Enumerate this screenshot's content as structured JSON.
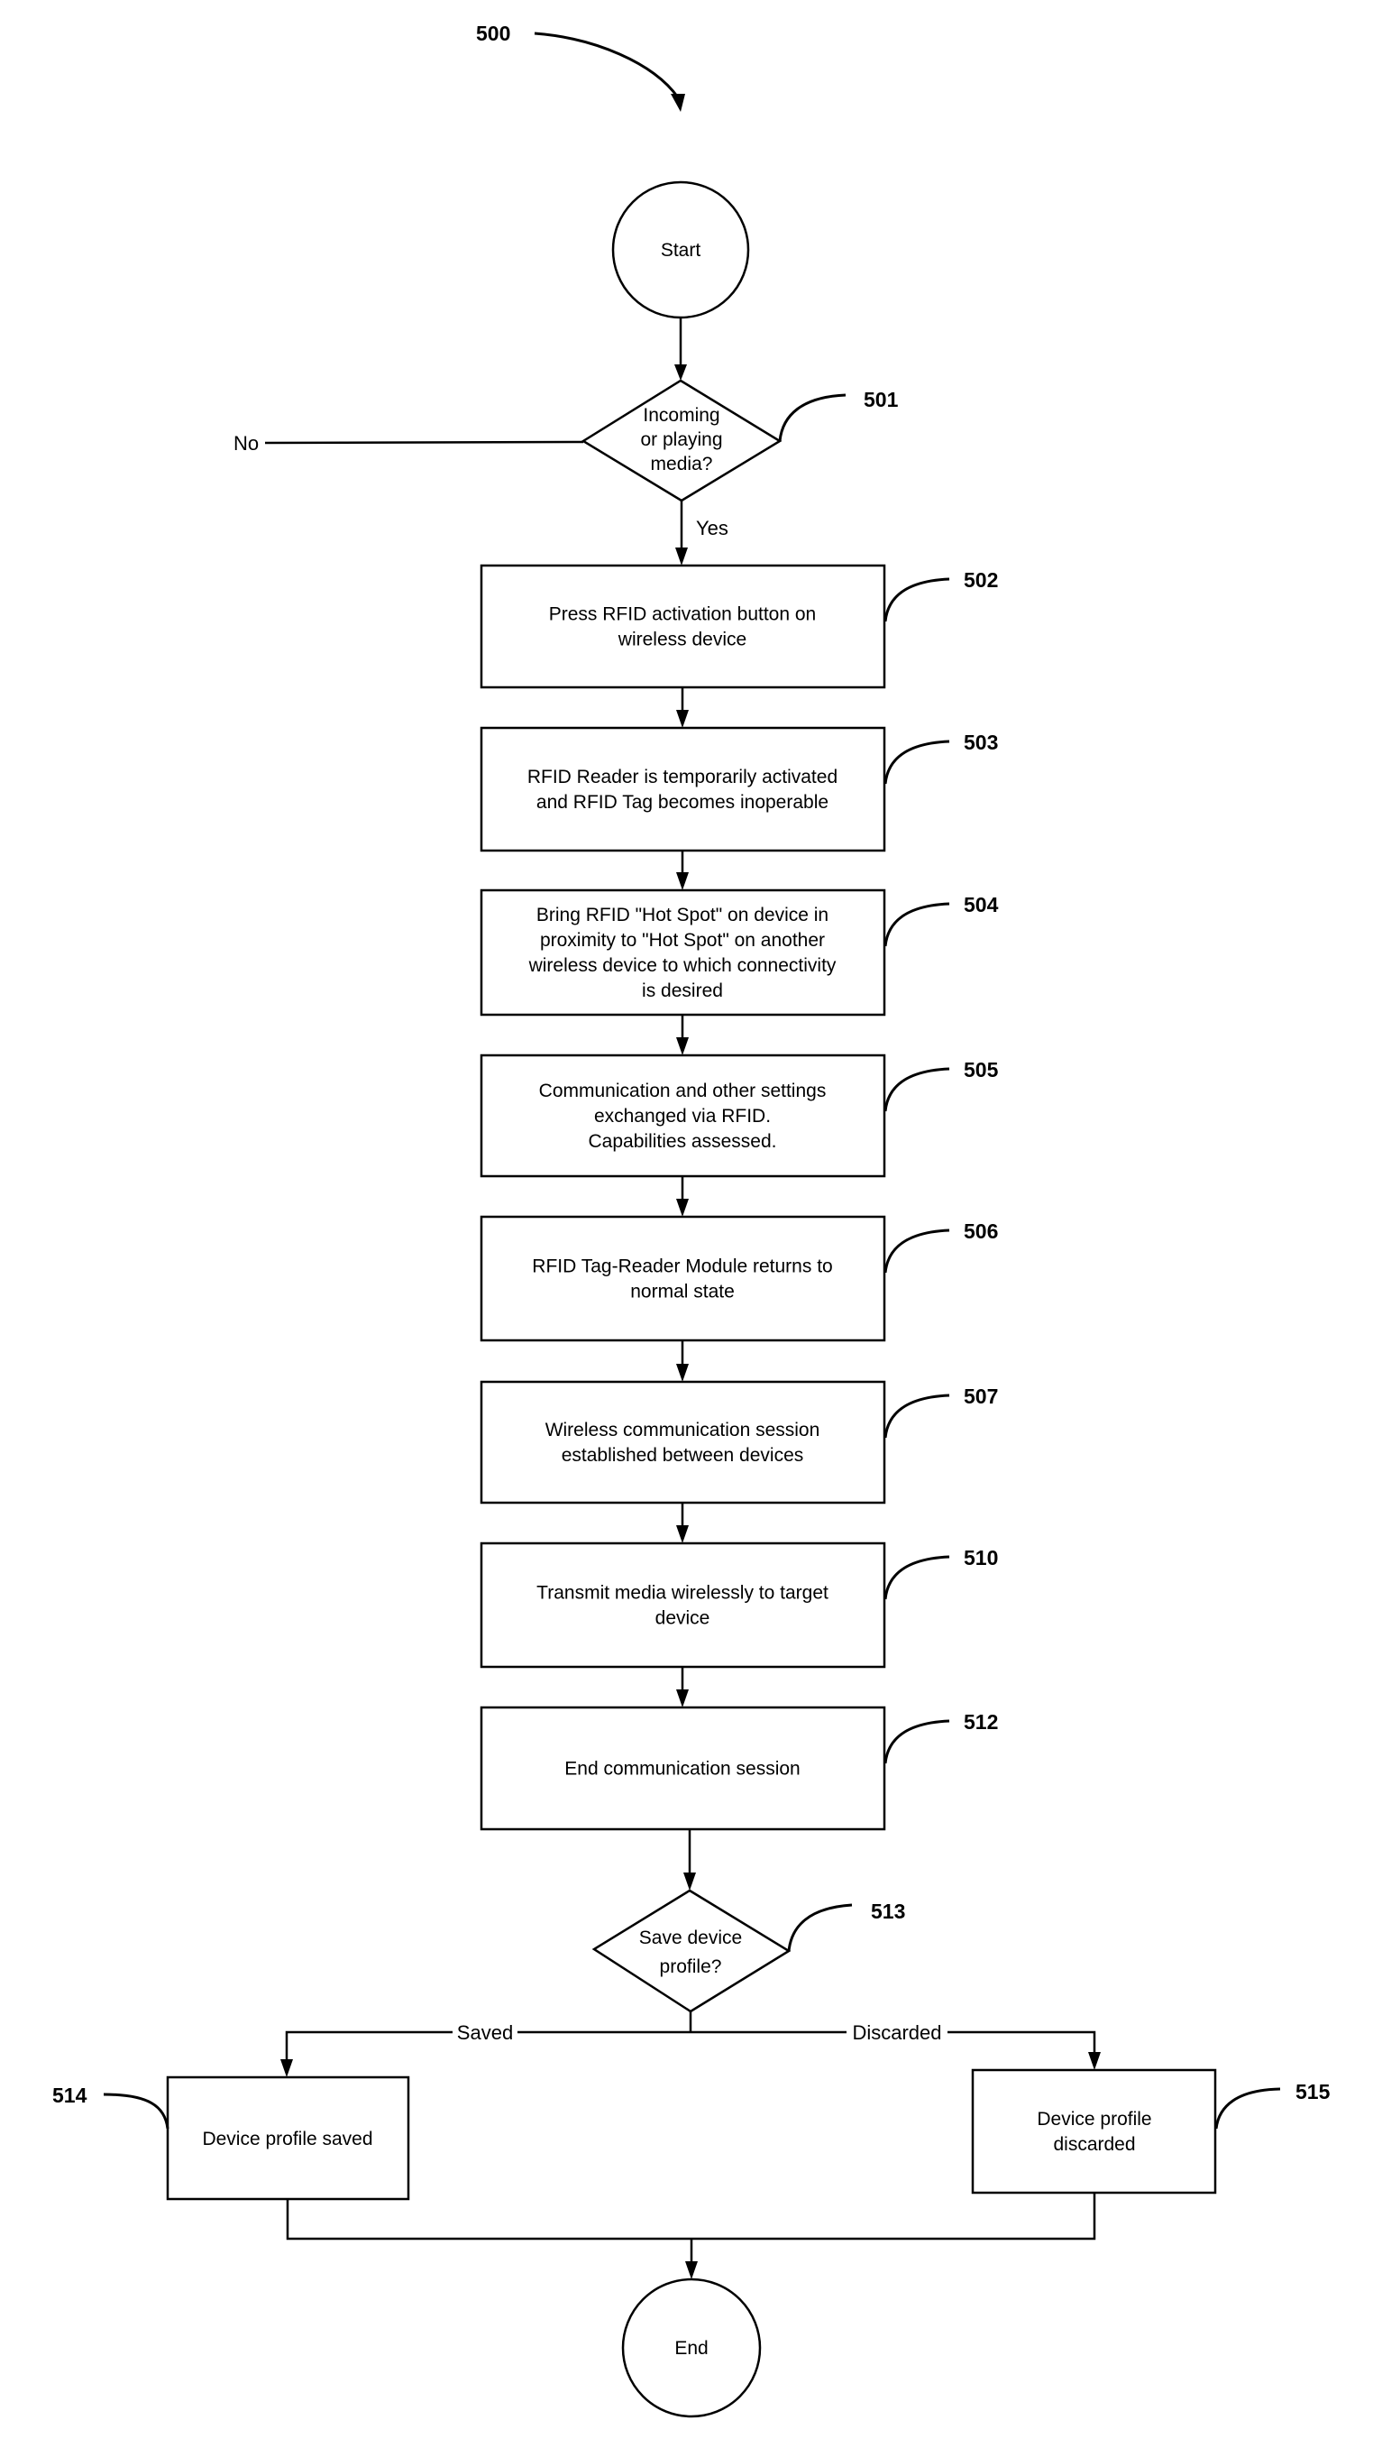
{
  "figure": {
    "reference": "500",
    "start_label": "Start",
    "end_label": "End"
  },
  "decisions": [
    {
      "id": "501",
      "lines": [
        "Incoming",
        "or playing",
        "media?"
      ],
      "no_label": "No",
      "yes_label": "Yes"
    },
    {
      "id": "513",
      "lines": [
        "Save device",
        "profile?"
      ],
      "left_label": "Saved",
      "right_label": "Discarded"
    }
  ],
  "steps": [
    {
      "id": "502",
      "lines": [
        "Press RFID activation button on",
        "wireless device"
      ]
    },
    {
      "id": "503",
      "lines": [
        "RFID Reader is temporarily activated",
        "and RFID Tag becomes inoperable"
      ]
    },
    {
      "id": "504",
      "lines": [
        "Bring RFID \"Hot Spot\" on device in",
        "proximity to \"Hot Spot\" on another",
        "wireless device  to which connectivity",
        "is desired"
      ]
    },
    {
      "id": "505",
      "lines": [
        "Communication and other settings",
        "exchanged via RFID.",
        "Capabilities assessed."
      ]
    },
    {
      "id": "506",
      "lines": [
        "RFID Tag-Reader Module returns to",
        "normal state"
      ]
    },
    {
      "id": "507",
      "lines": [
        "Wireless communication session",
        "established between devices"
      ]
    },
    {
      "id": "510",
      "lines": [
        "Transmit media wirelessly to target",
        "device"
      ]
    },
    {
      "id": "512",
      "lines": [
        "End communication session"
      ]
    }
  ],
  "outcomes": [
    {
      "id": "514",
      "lines": [
        "Device profile saved"
      ]
    },
    {
      "id": "515",
      "lines": [
        "Device profile",
        "discarded"
      ]
    }
  ]
}
